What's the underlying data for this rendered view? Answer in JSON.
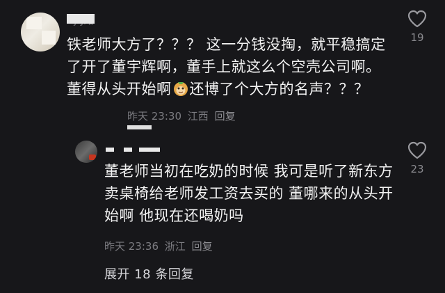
{
  "comments": [
    {
      "username": "- ʃ J路",
      "text_before_emoji": "铁老师大方了？？？ 这一分钱没掏，就平稳搞定了开了董宇辉啊，董手上就这么个空壳公司啊。董得从头开始啊",
      "emoji": "monkey-face-emoji",
      "text_after_emoji": "还博了个大方的名声？？？",
      "time": "昨天 23:30",
      "location": "江西",
      "reply_label": "回复",
      "like_count": "19"
    },
    {
      "text": "董老师当初在吃奶的时候 我可是听了新东方卖桌椅给老师发工资去买的 董哪来的从头开始啊 他现在还喝奶吗",
      "time": "昨天 23:36",
      "location": "浙江",
      "reply_label": "回复",
      "like_count": "23"
    }
  ],
  "expand_replies": "展开 18 条回复",
  "colors": {
    "background": "#17171a",
    "text": "#f2f2f2",
    "meta": "#7c7c81"
  }
}
